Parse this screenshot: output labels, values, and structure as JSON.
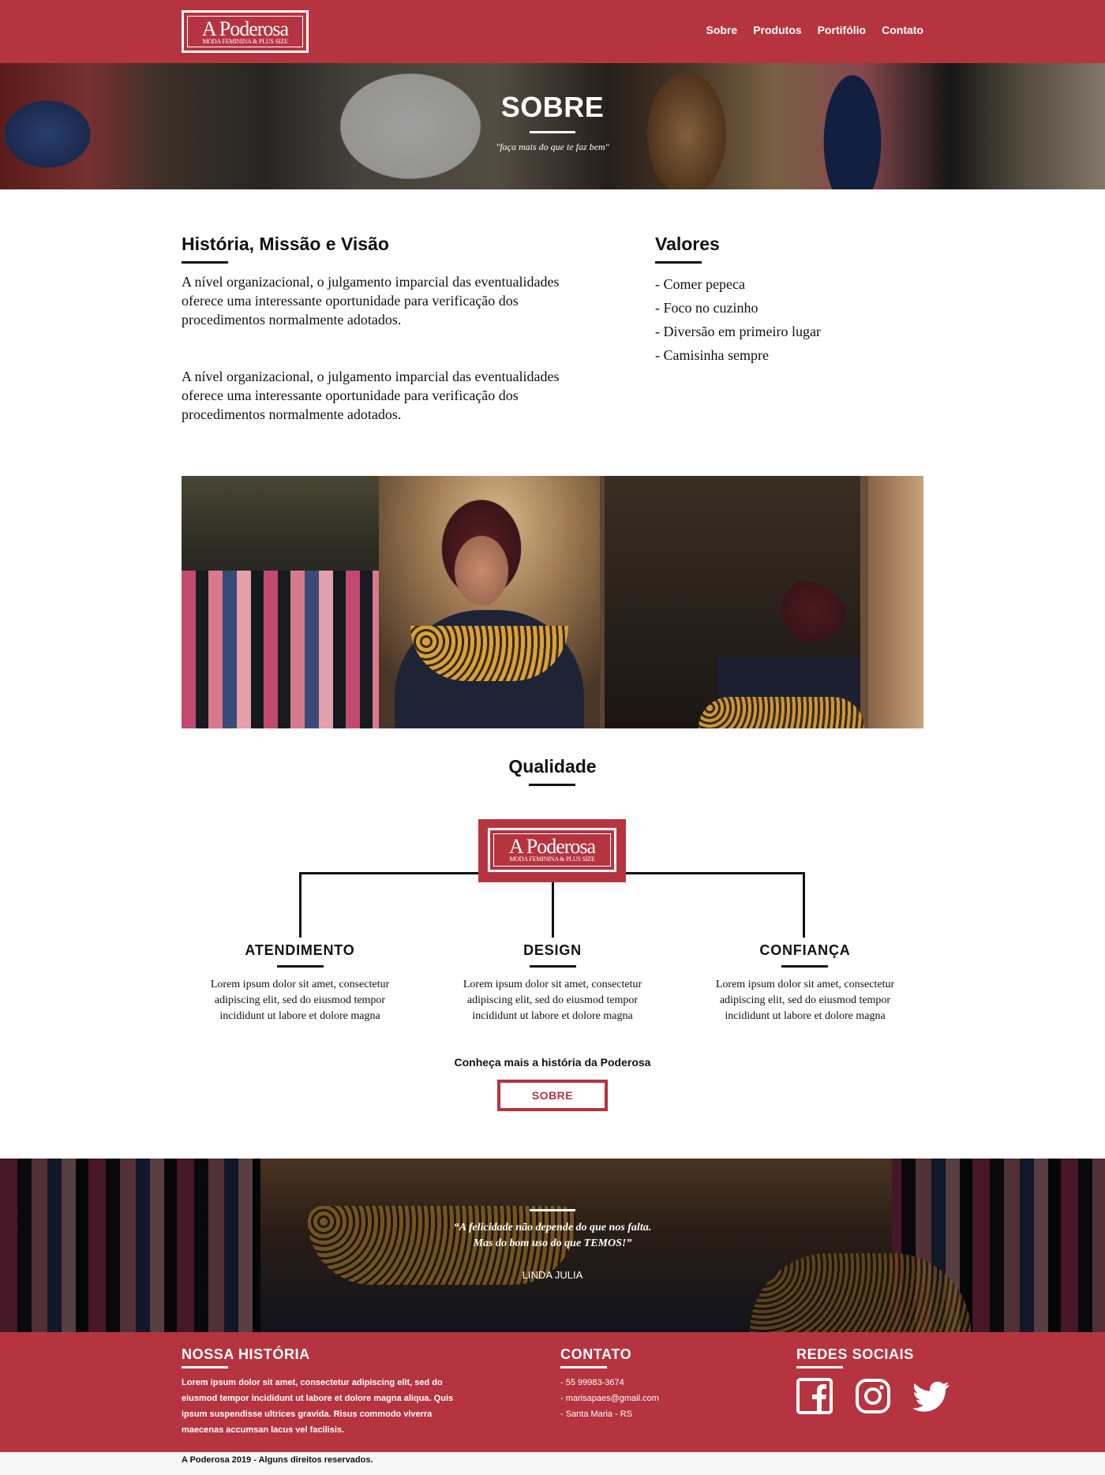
{
  "header": {
    "logo": {
      "title": "A Poderosa",
      "subtitle": "MODA FEMININA & PLUS SIZE"
    },
    "nav": [
      "Sobre",
      "Produtos",
      "Portifólio",
      "Contato"
    ]
  },
  "hero": {
    "title": "SOBRE",
    "subtitle": "\"faça mais do que te faz bem\""
  },
  "about": {
    "history_title": "História, Missão e Visão",
    "paragraphs": [
      "A nível organizacional, o julgamento imparcial das eventualidades oferece uma interessante oportunidade para verificação dos procedimentos normalmente adotados.",
      "A nível organizacional, o julgamento imparcial das eventualidades oferece uma interessante oportunidade para verificação dos procedimentos normalmente adotados."
    ],
    "values_title": "Valores",
    "values": [
      "- Comer pepeca",
      "- Foco no cuzinho",
      "- Diversão em primeiro lugar",
      "- Camisinha sempre"
    ]
  },
  "quality": {
    "title": "Qualidade",
    "logo": {
      "title": "A Poderosa",
      "subtitle": "MODA FEMININA & PLUS SIZE"
    },
    "columns": [
      {
        "title": "ATENDIMENTO",
        "text": "Lorem ipsum dolor sit amet, consectetur adipiscing elit, sed do eiusmod tempor incididunt ut labore et dolore magna"
      },
      {
        "title": "DESIGN",
        "text": "Lorem ipsum dolor sit amet, consectetur adipiscing elit, sed do eiusmod tempor incididunt ut labore et dolore magna"
      },
      {
        "title": "CONFIANÇA",
        "text": "Lorem ipsum dolor sit amet, consectetur adipiscing elit, sed do eiusmod tempor incididunt ut labore et dolore magna"
      }
    ],
    "cta_text": "Conheça mais a história da Poderosa",
    "cta_button": "SOBRE"
  },
  "quote": {
    "line1": "“A felicidade não depende do que nos falta.",
    "line2": "Mas do bom uso do que TEMOS!”",
    "author": "LINDA JULIA"
  },
  "footer": {
    "history_title": "NOSSA HISTÓRIA",
    "history_text": "Lorem ipsum dolor sit amet, consectetur adipiscing elit, sed do eiusmod tempor incididunt ut labore et dolore magna aliqua. Quis ipsum suspendisse ultrices gravida. Risus commodo viverra maecenas accumsan lacus vel facilisis.",
    "contact_title": "CONTATO",
    "contacts": [
      "- 55 99983-3674",
      "- marisapaes@gmail.com",
      "- Santa Maria - RS"
    ],
    "social_title": "REDES SOCIAIS",
    "social_icons": [
      "facebook-icon",
      "instagram-icon",
      "twitter-icon"
    ],
    "copyright": "A Poderosa 2019 - Alguns direitos reservados."
  },
  "colors": {
    "brand": "#b53440",
    "text": "#111111",
    "white": "#ffffff"
  }
}
